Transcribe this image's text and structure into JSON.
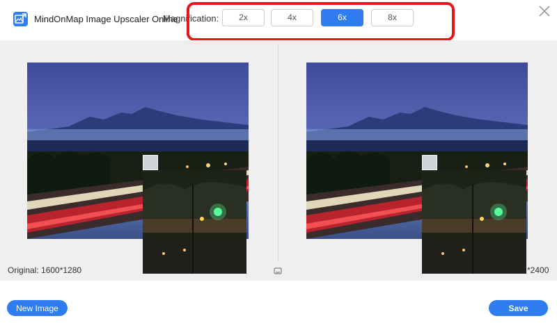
{
  "header": {
    "app_title": "MindOnMap Image Upscaler Online",
    "magnification_label": "Magnification:",
    "options": [
      "2x",
      "4x",
      "6x",
      "8x"
    ],
    "selected": "6x"
  },
  "preview": {
    "original_info": "Original: 1600*1280",
    "output_info": "*2400"
  },
  "footer": {
    "new_image_label": "New Image",
    "save_label": "Save"
  },
  "colors": {
    "accent": "#2e7cf0",
    "highlight": "#e4161c",
    "background": "#efefef"
  },
  "icons": {
    "app": "image-upscale-icon",
    "close": "close-icon",
    "compare": "compare-icon"
  }
}
